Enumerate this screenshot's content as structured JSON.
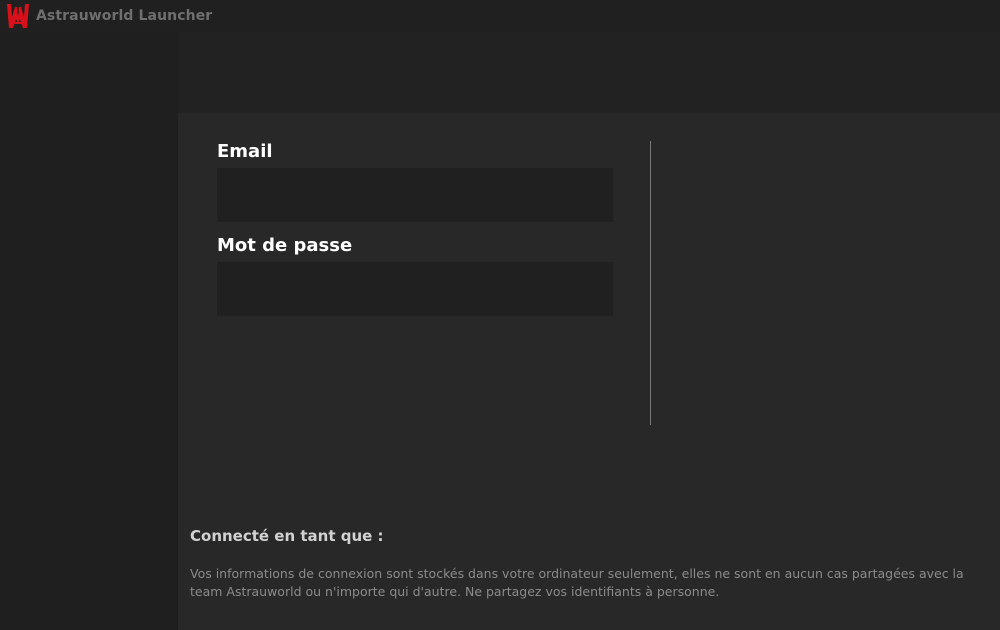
{
  "window": {
    "title": "Astrauworld Launcher",
    "logo_icon": "astrauworld-logo",
    "logo_color": "#d8101a"
  },
  "login_form": {
    "email_label": "Email",
    "email_value": "",
    "password_label": "Mot de passe",
    "password_value": ""
  },
  "account": {
    "connected_label": "Connecté en tant que :",
    "info_text": "Vos informations de connexion sont stockés dans votre ordinateur seulement, elles ne sont en aucun cas partagées avec la team Astrauworld ou n'importe qui d'autre. Ne partagez vos identifiants à personne."
  },
  "colors": {
    "background": "#1f1f1f",
    "panel": "#282828",
    "input": "#202020",
    "accent": "#d8101a"
  }
}
